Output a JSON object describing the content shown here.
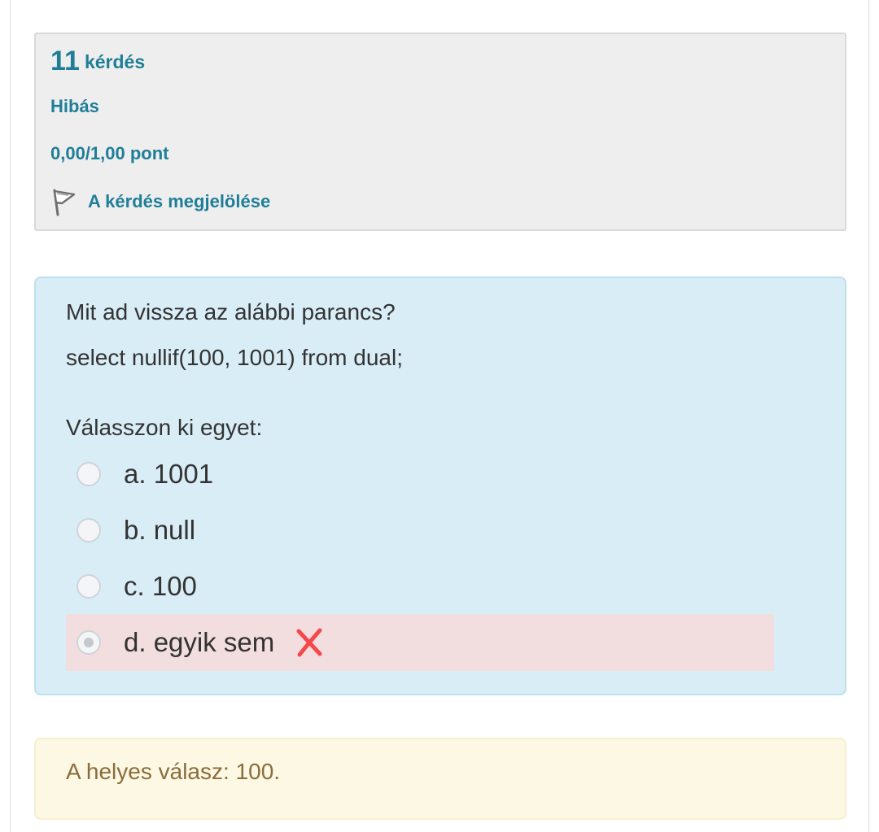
{
  "info": {
    "question_number": "11",
    "question_word": "kérdés",
    "state": "Hibás",
    "grade": "0,00/1,00 pont",
    "flag_label": "A kérdés megjelölése",
    "flag_icon": "flag-icon"
  },
  "question": {
    "line1": "Mit ad vissza az alábbi parancs?",
    "line2": "select nullif(100, 1001) from dual;",
    "prompt": "Válasszon ki egyet:",
    "options": [
      {
        "label": "a. 1001",
        "checked": false
      },
      {
        "label": "b. null",
        "checked": false
      },
      {
        "label": "c. 100",
        "checked": false
      },
      {
        "label": "d. egyik sem",
        "checked": true,
        "status": "incorrect",
        "icon": "cross-icon"
      }
    ]
  },
  "feedback": {
    "right_answer": "A helyes válasz: 100."
  },
  "colors": {
    "link": "#1f7e97",
    "question_bg": "#d9edf7",
    "incorrect_bg": "#f2dede",
    "feedback_bg": "#fcf8e3",
    "feedback_text": "#8a6d3b",
    "cross": "#f5484b"
  }
}
